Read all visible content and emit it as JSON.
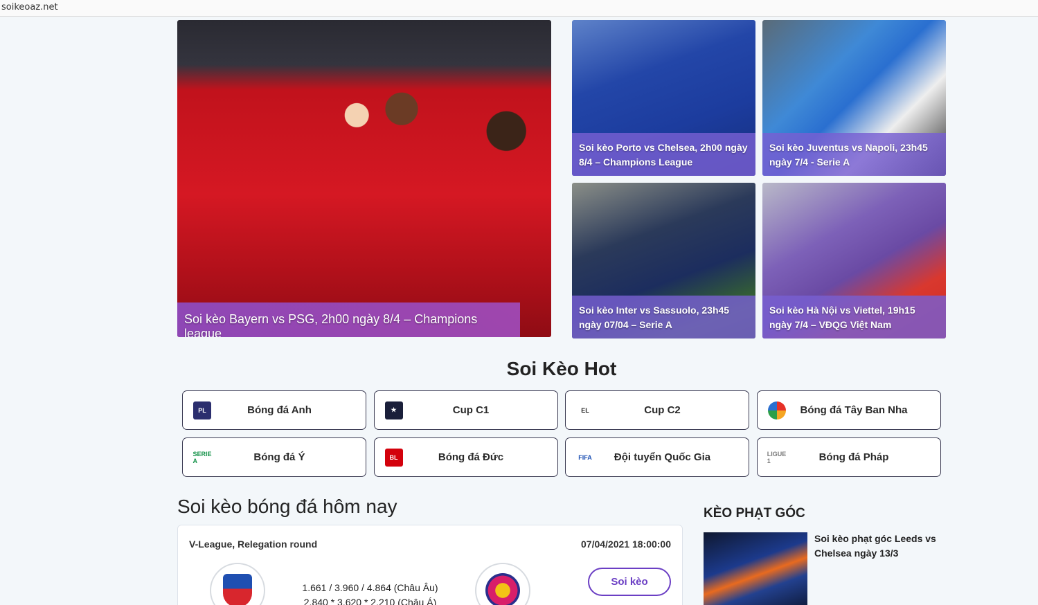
{
  "browser": {
    "url": "soikeoaz.net"
  },
  "featured": {
    "main": {
      "title": "Soi kèo Bayern vs PSG, 2h00 ngày 8/4 – Champions league"
    },
    "side": [
      {
        "title": "Soi kèo Porto vs Chelsea, 2h00 ngày 8/4 – Champions League"
      },
      {
        "title": "Soi kèo Juventus vs Napoli, 23h45 ngày 7/4 - Serie A"
      },
      {
        "title": "Soi kèo Inter vs Sassuolo, 23h45 ngày 07/04 – Serie A"
      },
      {
        "title": "Soi kèo Hà Nội vs Viettel, 19h15 ngày 7/4 – VĐQG Việt Nam"
      }
    ]
  },
  "hot": {
    "title": "Soi Kèo Hot",
    "leagues": [
      {
        "label": "Bóng đá Anh",
        "icon": "premier-league-icon",
        "abbr": "PL"
      },
      {
        "label": "Cup C1",
        "icon": "champions-league-icon",
        "abbr": "★"
      },
      {
        "label": "Cup C2",
        "icon": "europa-league-icon",
        "abbr": "EL"
      },
      {
        "label": "Bóng đá Tây Ban Nha",
        "icon": "laliga-icon",
        "abbr": ""
      },
      {
        "label": "Bóng đá Ý",
        "icon": "serie-a-icon",
        "abbr": "SERIE A"
      },
      {
        "label": "Bóng đá Đức",
        "icon": "bundesliga-icon",
        "abbr": "BL"
      },
      {
        "label": "Đội tuyển Quốc Gia",
        "icon": "fifa-icon",
        "abbr": "FIFA"
      },
      {
        "label": "Bóng đá Pháp",
        "icon": "ligue1-icon",
        "abbr": "LIGUE 1"
      }
    ]
  },
  "today": {
    "title": "Soi kèo bóng đá hôm nay",
    "match": {
      "league": "V-League, Relegation round",
      "datetime": "07/04/2021 18:00:00",
      "odds_eu": "1.661 / 3.960 / 4.864 (Châu Âu)",
      "odds_asia": "2.840 * 3.620 * 2.210 (Châu Á)",
      "button": "Soi kèo"
    }
  },
  "sidebar": {
    "title": "KÈO PHẠT GÓC",
    "article": "Soi kèo phạt góc Leeds vs Chelsea ngày 13/3"
  },
  "colors": {
    "accent": "#6b3fc4",
    "caption": "#7860d2",
    "background": "#f3f7fa"
  }
}
